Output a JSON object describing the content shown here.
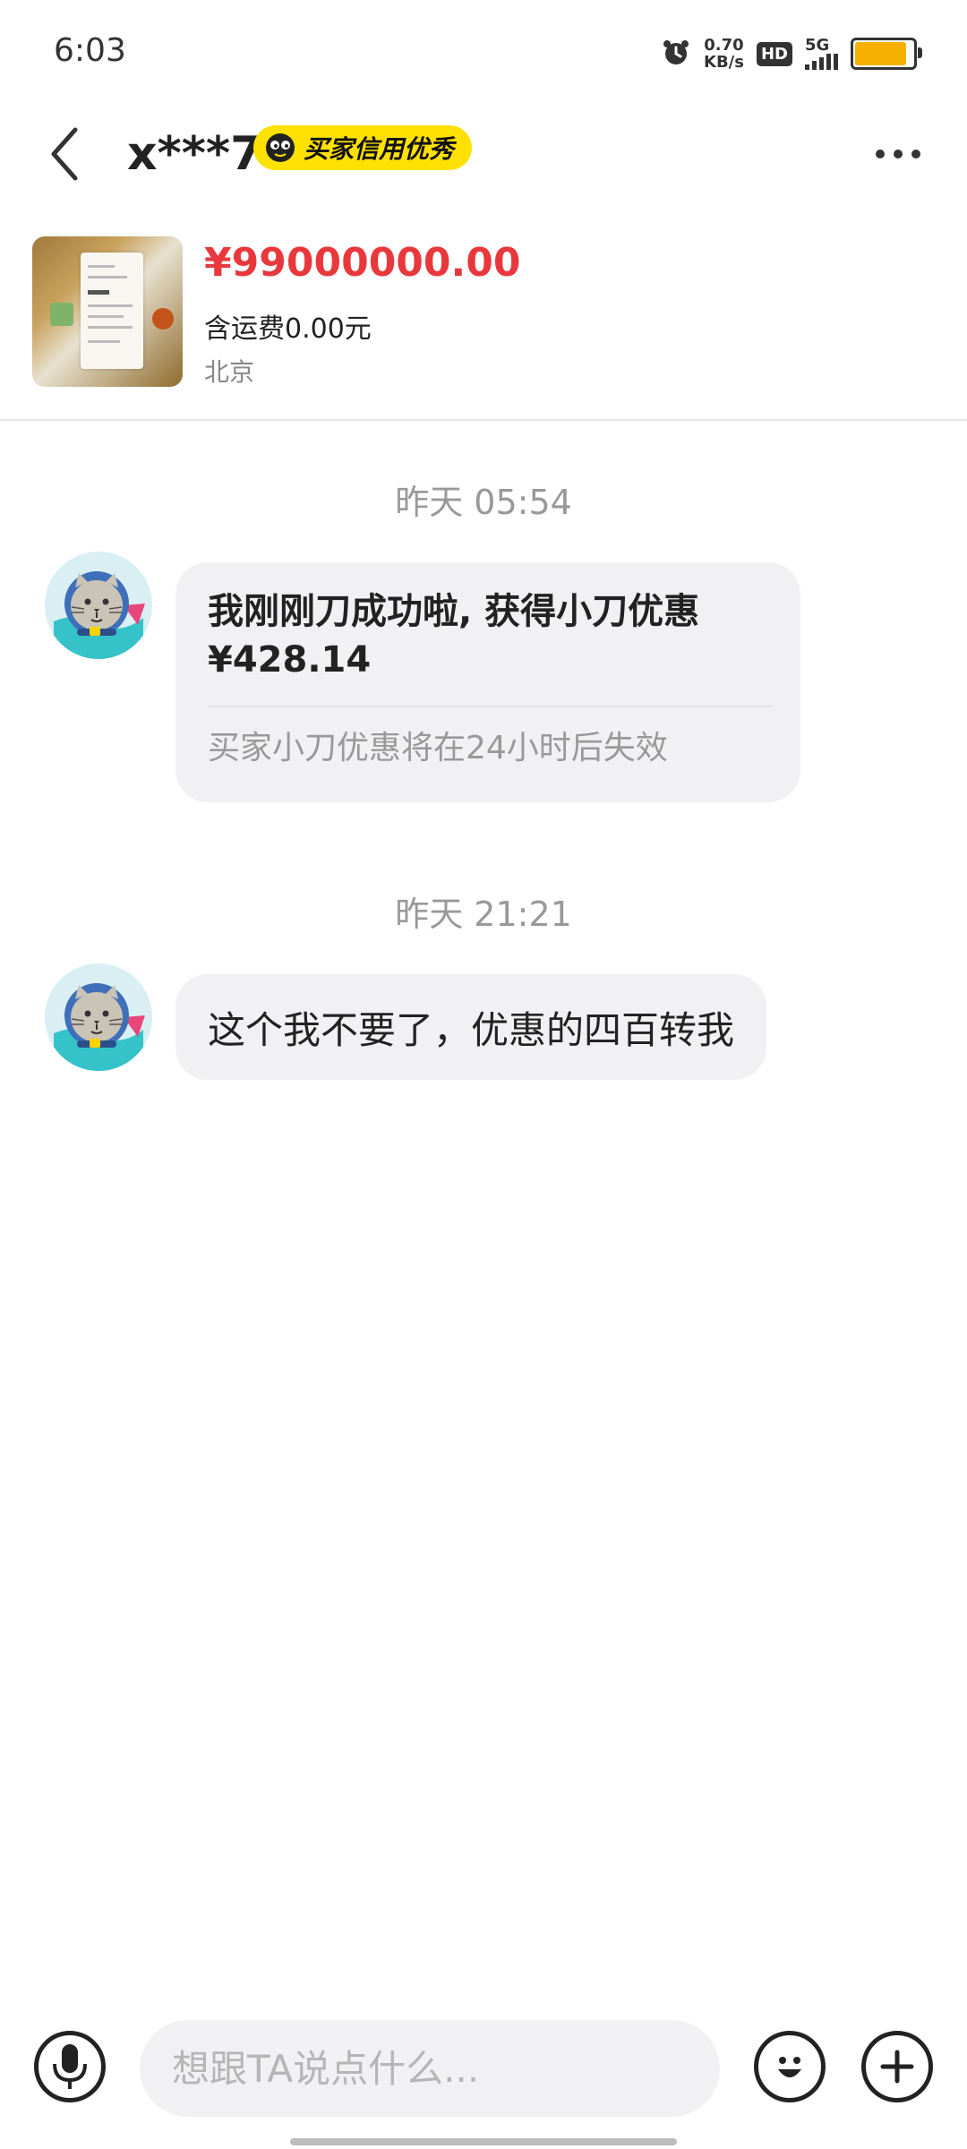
{
  "status_bar": {
    "time": "6:03",
    "net_speed_value": "0.70",
    "net_speed_unit": "KB/s",
    "hd": "HD",
    "network": "5G",
    "battery_level": 0.9,
    "battery_color": "#f6b100"
  },
  "header": {
    "title": "x***7",
    "badge": "买家信用优秀",
    "badge_color": "#ffe100"
  },
  "product": {
    "price": "¥99000000.00",
    "shipping": "含运费0.00元",
    "location": "北京",
    "price_color": "#e8383d"
  },
  "messages": [
    {
      "timestamp": "昨天 05:54",
      "title": "我刚刚刀成功啦, 获得小刀优惠¥428.14",
      "note": "买家小刀优惠将在24小时后失效"
    },
    {
      "timestamp": "昨天 21:21",
      "text": "这个我不要了，优惠的四百转我"
    }
  ],
  "input": {
    "placeholder": "想跟TA说点什么..."
  },
  "icons": [
    "clock-alarm-icon",
    "back-arrow-icon",
    "more-icon",
    "voice-icon",
    "emoji-icon",
    "plus-icon"
  ]
}
